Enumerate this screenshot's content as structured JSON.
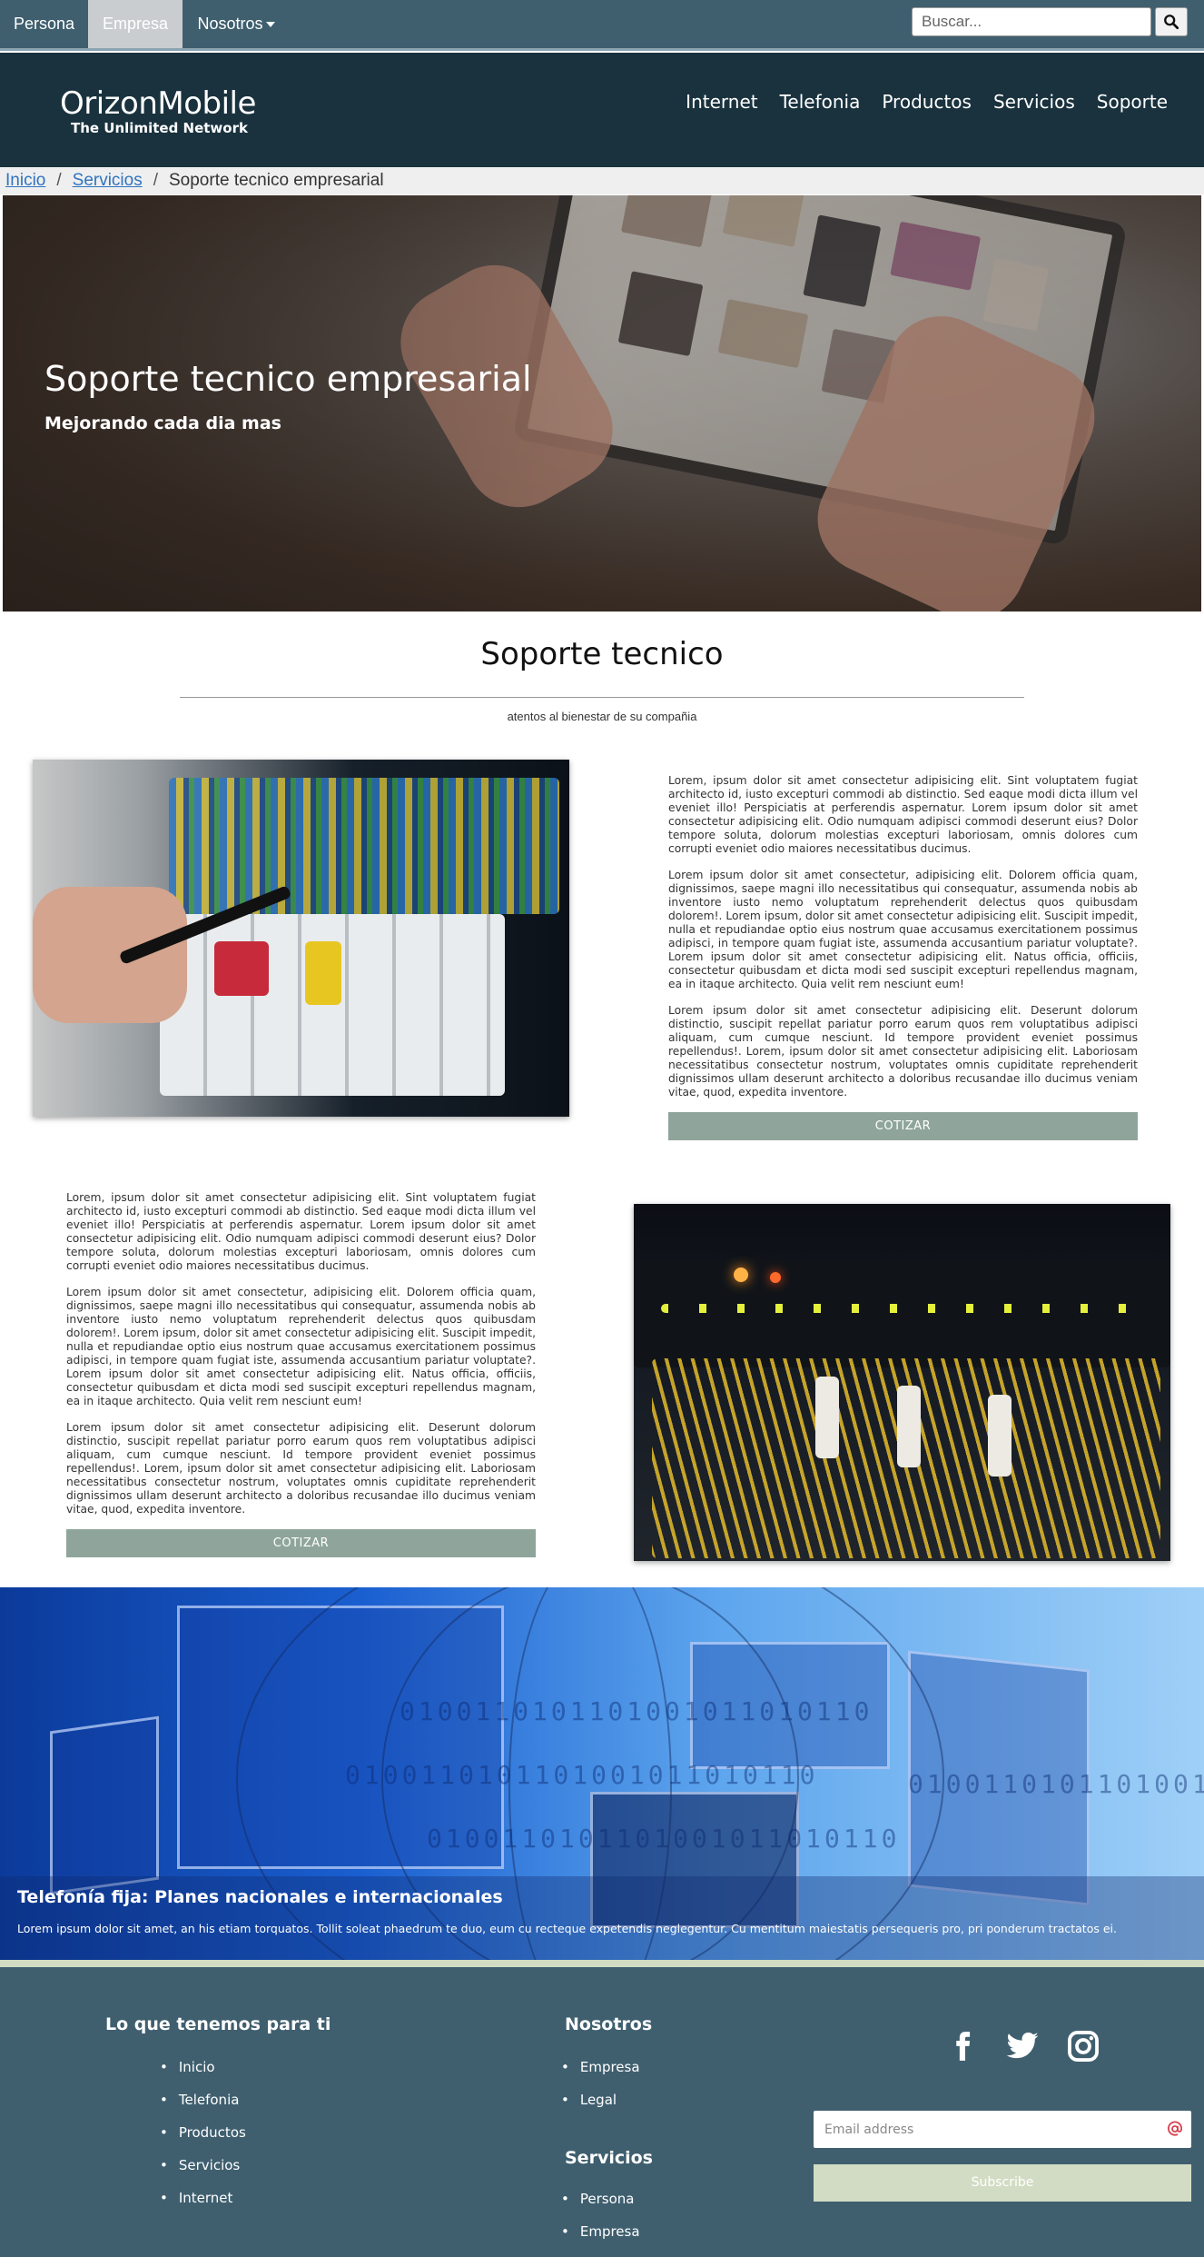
{
  "topbar": {
    "segments": [
      "Persona",
      "Empresa",
      "Nosotros"
    ],
    "search_placeholder": "Buscar..."
  },
  "header": {
    "brand": "OrizonMobile",
    "tagline": "The Unlimited Network",
    "nav": [
      "Internet",
      "Telefonia",
      "Productos",
      "Servicios",
      "Soporte"
    ]
  },
  "breadcrumb": [
    "Inicio",
    "Servicios",
    "Soporte tecnico empresarial"
  ],
  "hero": {
    "title": "Soporte tecnico empresarial",
    "subtitle": "Mejorando cada dia mas"
  },
  "section": {
    "title": "Soporte tecnico",
    "subtitle": "atentos al bienestar de su compañia"
  },
  "blocks": [
    {
      "paragraphs": [
        "Lorem, ipsum dolor sit amet consectetur adipisicing elit. Sint voluptatem fugiat architecto id, iusto excepturi commodi ab distinctio. Sed eaque modi dicta illum vel eveniet illo! Perspiciatis at perferendis aspernatur. Lorem ipsum dolor sit amet consectetur adipisicing elit. Odio numquam adipisci commodi deserunt eius? Dolor tempore soluta, dolorum molestias excepturi laboriosam, omnis dolores cum corrupti eveniet odio maiores necessitatibus ducimus.",
        "Lorem ipsum dolor sit amet consectetur, adipisicing elit. Dolorem officia quam, dignissimos, saepe magni illo necessitatibus qui consequatur, assumenda nobis ab inventore iusto nemo voluptatum reprehenderit delectus quos quibusdam dolorem!. Lorem ipsum, dolor sit amet consectetur adipisicing elit. Suscipit impedit, nulla et repudiandae optio eius nostrum quae accusamus exercitationem possimus adipisci, in tempore quam fugiat iste, assumenda accusantium pariatur voluptate?. Lorem ipsum dolor sit amet consectetur adipisicing elit. Natus officia, officiis, consectetur quibusdam et dicta modi sed suscipit excepturi repellendus magnam, ea in itaque architecto. Quia velit rem nesciunt eum!",
        "Lorem ipsum dolor sit amet consectetur adipisicing elit. Deserunt dolorum distinctio, suscipit repellat pariatur porro earum quos rem voluptatibus adipisci aliquam, cum cumque nesciunt. Id tempore provident eveniet possimus repellendus!. Lorem, ipsum dolor sit amet consectetur adipisicing elit. Laboriosam necessitatibus consectetur nostrum, voluptates omnis cupiditate reprehenderit dignissimos ullam deserunt architecto a doloribus recusandae illo ducimus veniam vitae, quod, expedita inventore."
      ],
      "button": "COTIZAR"
    },
    {
      "paragraphs": [
        "Lorem, ipsum dolor sit amet consectetur adipisicing elit. Sint voluptatem fugiat architecto id, iusto excepturi commodi ab distinctio. Sed eaque modi dicta illum vel eveniet illo! Perspiciatis at perferendis aspernatur. Lorem ipsum dolor sit amet consectetur adipisicing elit. Odio numquam adipisci commodi deserunt eius? Dolor tempore soluta, dolorum molestias excepturi laboriosam, omnis dolores cum corrupti eveniet odio maiores necessitatibus ducimus.",
        "Lorem ipsum dolor sit amet consectetur, adipisicing elit. Dolorem officia quam, dignissimos, saepe magni illo necessitatibus qui consequatur, assumenda nobis ab inventore iusto nemo voluptatum reprehenderit delectus quos quibusdam dolorem!. Lorem ipsum, dolor sit amet consectetur adipisicing elit. Suscipit impedit, nulla et repudiandae optio eius nostrum quae accusamus exercitationem possimus adipisci, in tempore quam fugiat iste, assumenda accusantium pariatur voluptate?. Lorem ipsum dolor sit amet consectetur adipisicing elit. Natus officia, officiis, consectetur quibusdam et dicta modi sed suscipit excepturi repellendus magnam, ea in itaque architecto. Quia velit rem nesciunt eum!",
        "Lorem ipsum dolor sit amet consectetur adipisicing elit. Deserunt dolorum distinctio, suscipit repellat pariatur porro earum quos rem voluptatibus adipisci aliquam, cum cumque nesciunt. Id tempore provident eveniet possimus repellendus!. Lorem, ipsum dolor sit amet consectetur adipisicing elit. Laboriosam necessitatibus consectetur nostrum, voluptates omnis cupiditate reprehenderit dignissimos ullam deserunt architecto a doloribus recusandae illo ducimus veniam vitae, quod, expedita inventore."
      ],
      "button": "COTIZAR"
    }
  ],
  "banner": {
    "title": "Telefonía fija: Planes nacionales e internacionales",
    "text": "Lorem ipsum dolor sit amet, an his etiam torquatos. Tollit soleat phaedrum te duo, eum cu recteque expetendis neglegentur. Cu mentitum maiestatis persequeris pro, pri ponderum tractatos ei.",
    "binary": "0100110101101001011010110"
  },
  "footer": {
    "col1_title": "Lo que tenemos para ti",
    "col1_items": [
      "Inicio",
      "Telefonia",
      "Productos",
      "Servicios",
      "Internet"
    ],
    "col2_title": "Nosotros",
    "col2_items": [
      "Empresa",
      "Legal"
    ],
    "col3_title": "Servicios",
    "col3_items": [
      "Persona",
      "Empresa"
    ],
    "email_placeholder": "Email address",
    "subscribe_label": "Subscribe",
    "social_icons": [
      "facebook-icon",
      "twitter-icon",
      "instagram-icon"
    ]
  },
  "colors": {
    "topbar": "#3f5f6f",
    "header": "#19323e",
    "button": "#8fa59c",
    "subscribe": "#d2dcc4",
    "link": "#2f74c0"
  }
}
